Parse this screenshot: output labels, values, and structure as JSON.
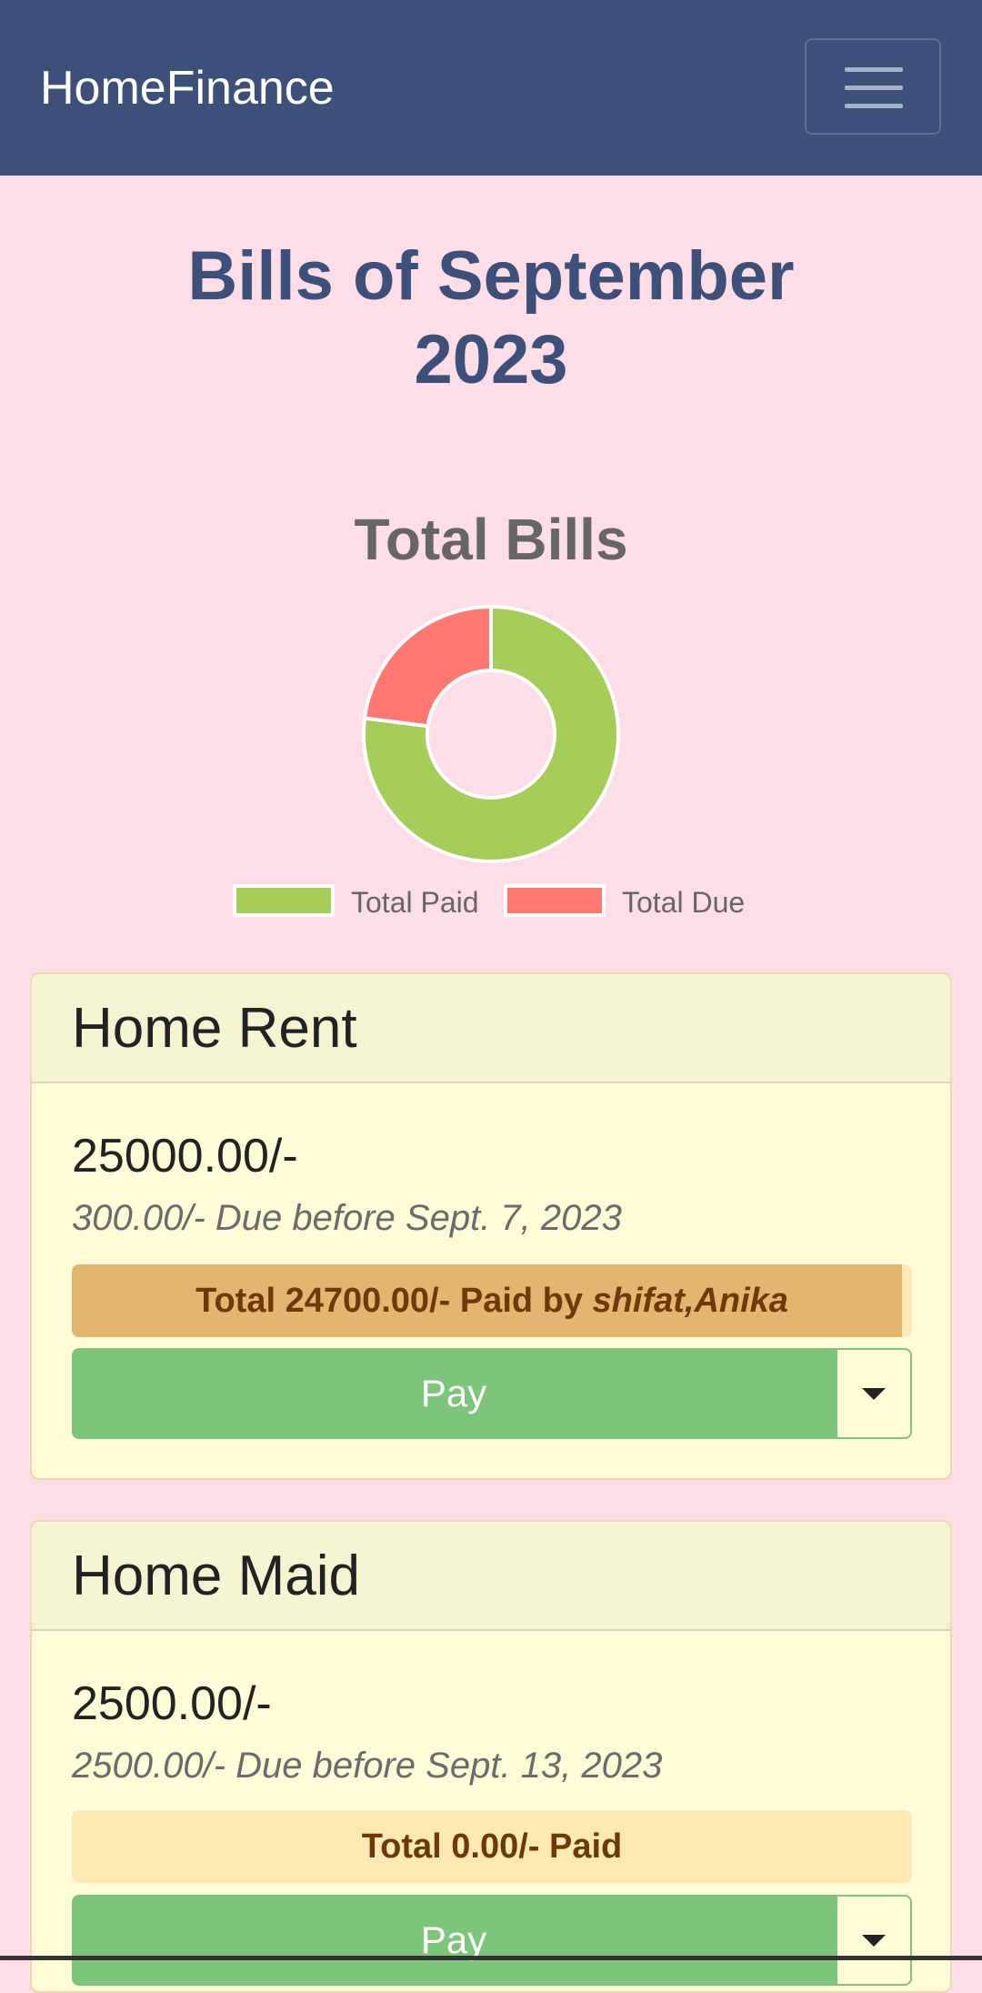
{
  "navbar": {
    "brand": "HomeFinance",
    "menu_icon": "hamburger-menu-icon"
  },
  "page": {
    "title_line1": "Bills of September",
    "title_line2": "2023"
  },
  "chart_data": {
    "type": "pie",
    "style": "doughnut",
    "title": "Total Bills",
    "categories": [
      "Total Paid",
      "Total Due"
    ],
    "values": [
      77,
      23
    ],
    "colors": [
      "#a5cd58",
      "#fe7770"
    ],
    "legend": "bottom"
  },
  "bills": [
    {
      "name": "Home Rent",
      "amount": "25000.00/-",
      "due": "300.00/- Due before Sept. 7, 2023",
      "paid_prefix": "Total 24700.00/- Paid by ",
      "paid_by": "shifat,Anika",
      "paid_fraction": 0.988,
      "pay_label": "Pay"
    },
    {
      "name": "Home Maid",
      "amount": "2500.00/-",
      "due": "2500.00/- Due before Sept. 13, 2023",
      "paid_prefix": "Total 0.00/- Paid",
      "paid_by": "",
      "paid_fraction": 0,
      "pay_label": "Pay"
    }
  ],
  "colors": {
    "navbar": "#3d5079",
    "background": "#fddde6",
    "card": "#fefcd7",
    "pay_button": "#7dc57a",
    "progress_fill": "#e2b66e",
    "progress_track": "#fbe8b5"
  }
}
